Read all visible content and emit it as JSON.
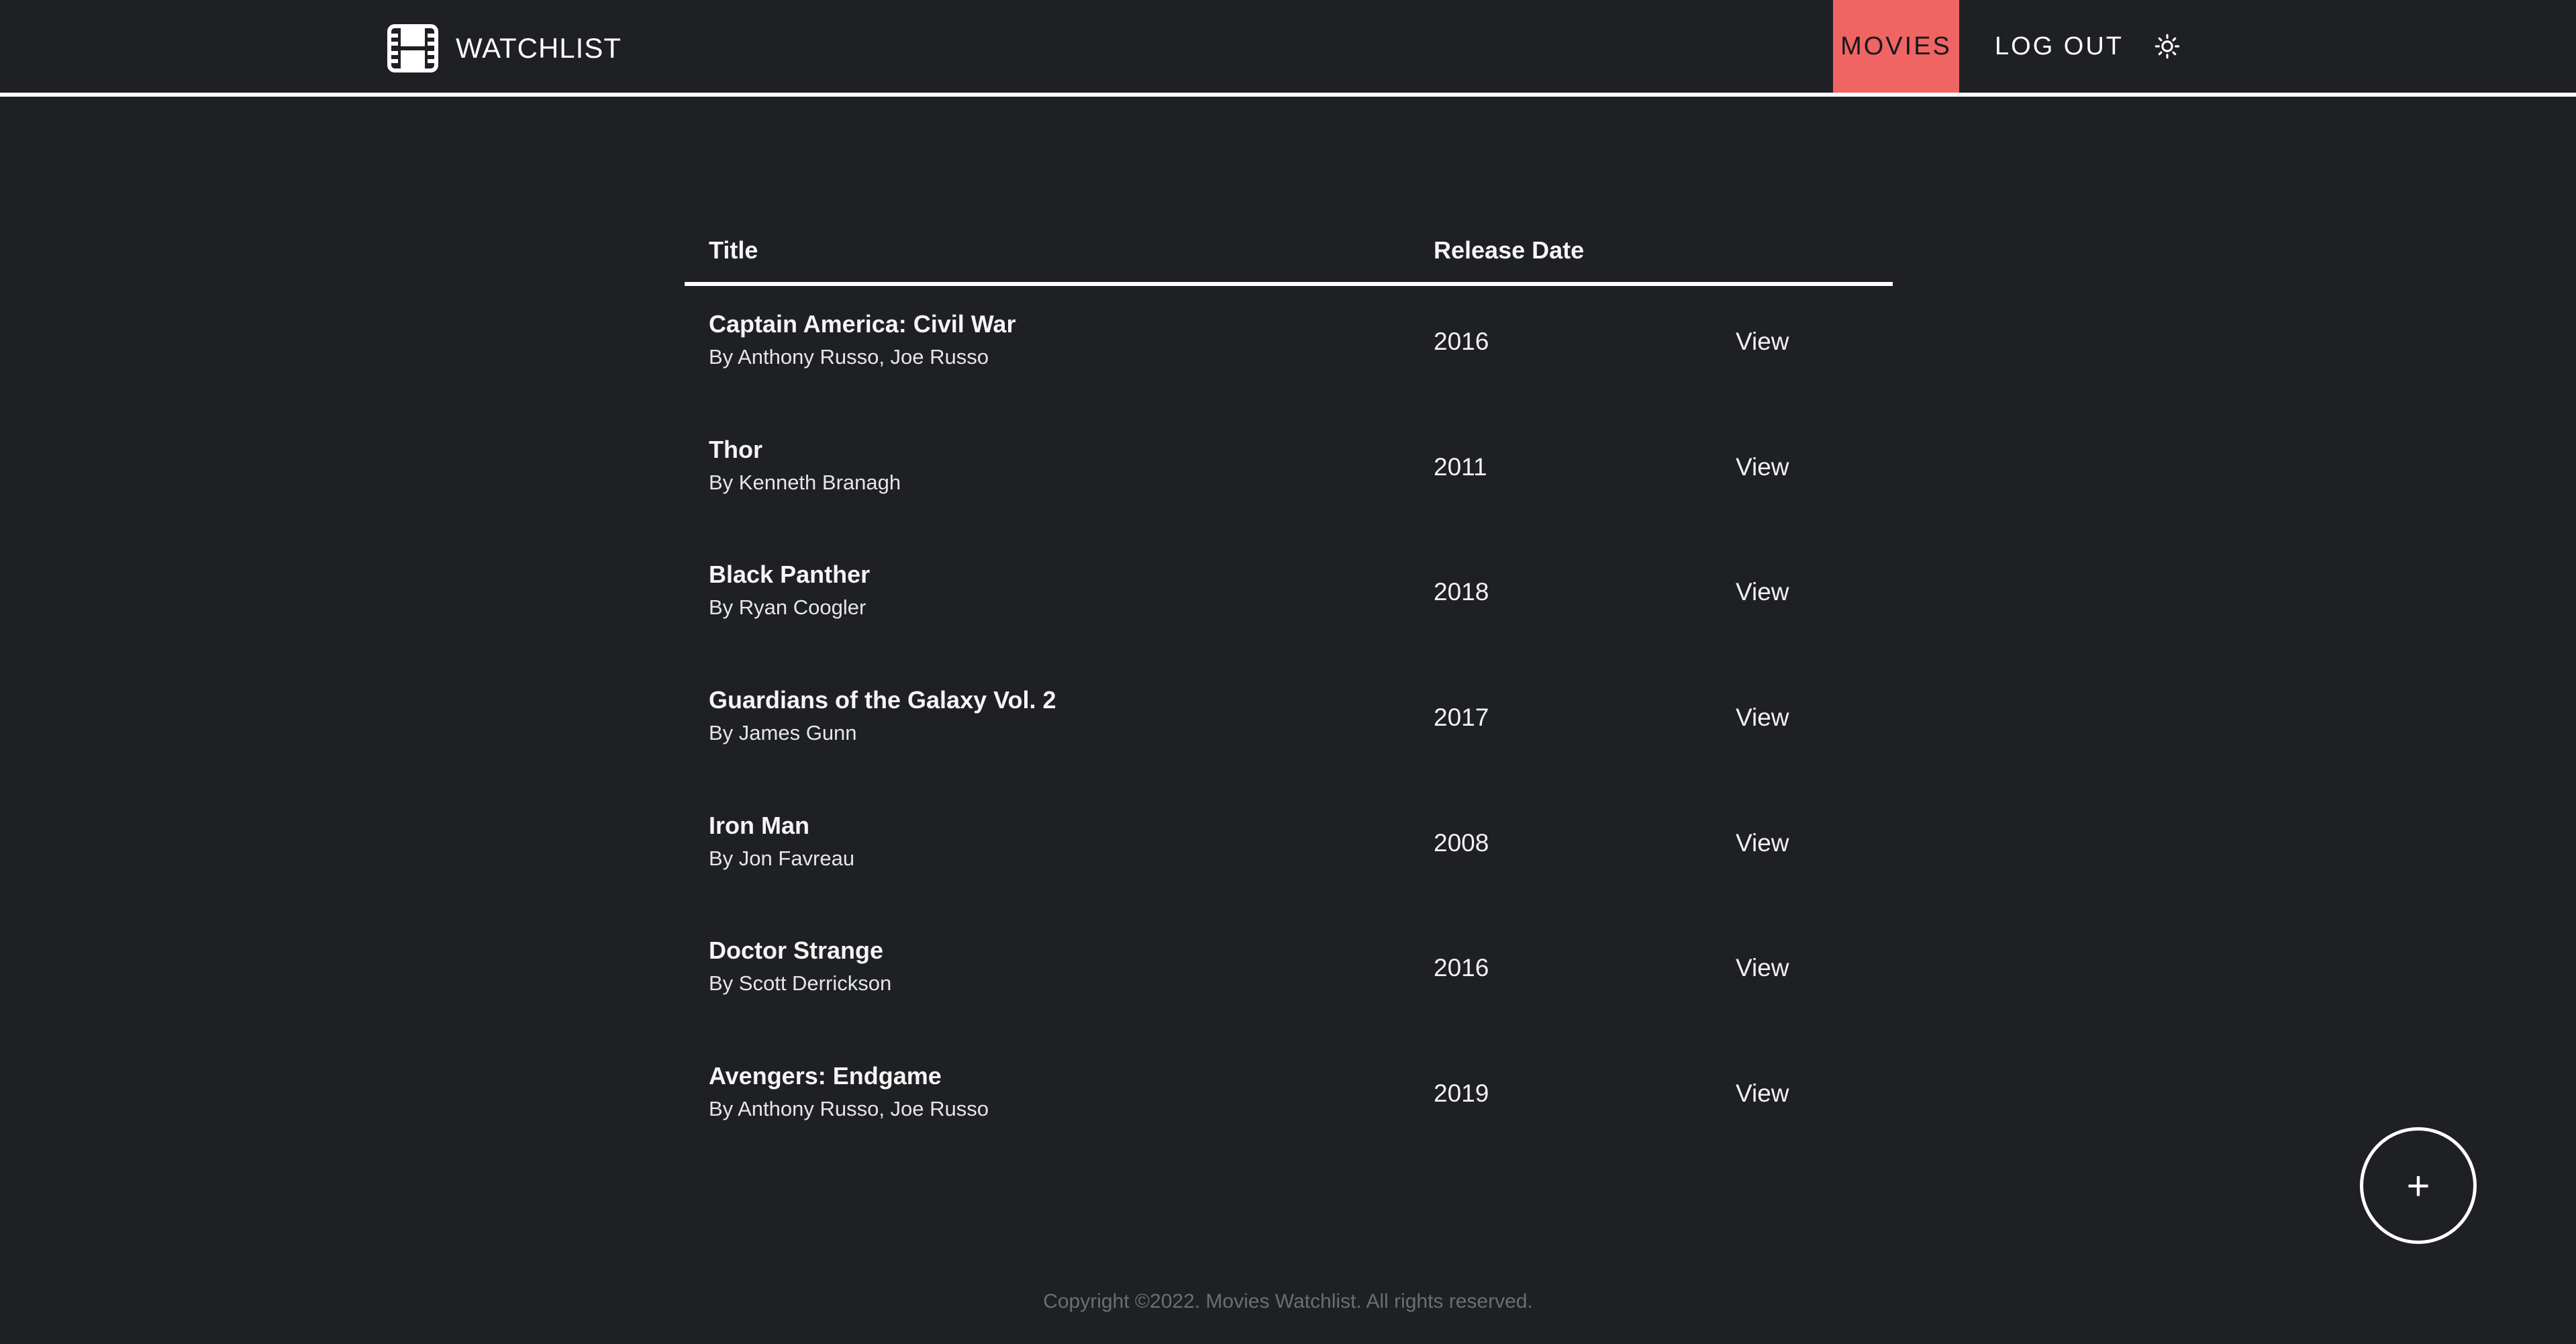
{
  "header": {
    "brand_icon": "film-icon",
    "brand_name": "WATCHLIST",
    "nav": {
      "movies_label": "MOVIES",
      "logout_label": "LOG OUT"
    },
    "theme_icon": "sun-icon",
    "active_color": "#f06464"
  },
  "table": {
    "columns": {
      "title": "Title",
      "release_date": "Release Date"
    },
    "rows": [
      {
        "title": "Captain America: Civil War",
        "director": "By Anthony Russo, Joe Russo",
        "year": "2016",
        "action": "View"
      },
      {
        "title": "Thor",
        "director": "By Kenneth Branagh",
        "year": "2011",
        "action": "View"
      },
      {
        "title": "Black Panther",
        "director": "By Ryan Coogler",
        "year": "2018",
        "action": "View"
      },
      {
        "title": "Guardians of the Galaxy Vol. 2",
        "director": "By James Gunn",
        "year": "2017",
        "action": "View"
      },
      {
        "title": "Iron Man",
        "director": "By Jon Favreau",
        "year": "2008",
        "action": "View"
      },
      {
        "title": "Doctor Strange",
        "director": "By Scott Derrickson",
        "year": "2016",
        "action": "View"
      },
      {
        "title": "Avengers: Endgame",
        "director": "By Anthony Russo, Joe Russo",
        "year": "2019",
        "action": "View"
      }
    ]
  },
  "fab": {
    "label": "+",
    "icon": "plus-icon"
  },
  "footer": {
    "copyright": "Copyright ©2022. Movies Watchlist. All rights reserved."
  }
}
